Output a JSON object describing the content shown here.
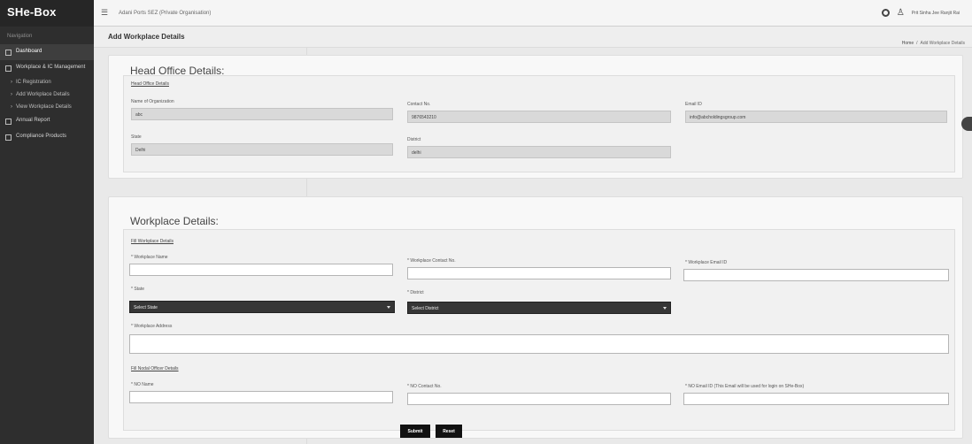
{
  "brand": "SHe-Box",
  "sidebar": {
    "heading": "Navigation",
    "items": [
      {
        "label": "Dashboard",
        "active": true
      },
      {
        "label": "Workplace & IC Management",
        "active": false
      },
      {
        "label": "IC Registration",
        "sub": true
      },
      {
        "label": "Add Workplace Details",
        "sub": true
      },
      {
        "label": "View Workplace Details",
        "sub": true
      },
      {
        "label": "Annual Report",
        "active": false
      },
      {
        "label": "Compliance Products",
        "active": false
      }
    ]
  },
  "topbar": {
    "org_name": "Adani Ports SEZ (Private Organisation)",
    "user_name": "Prit Sinha Jee Ranjit Rai"
  },
  "titlebar": {
    "title": "Add Workplace Details",
    "breadcrumb_home": "Home",
    "breadcrumb_sep": "/",
    "breadcrumb_current": "Add Workplace Details"
  },
  "head_office": {
    "card_title": "Head Office Details:",
    "section_link": "Head Office Details",
    "org_label": "Name of Organization",
    "org_value": "abc",
    "contact_label": "Contact No.",
    "contact_value": "9876543210",
    "email_label": "Email ID",
    "email_value": "info@abcholdingsgroup.com",
    "state_label": "State",
    "state_value": "Delhi",
    "district_label": "District",
    "district_value": "delhi"
  },
  "workplace": {
    "card_title": "Workplace Details:",
    "section_link": "Fill Workplace Details",
    "name_label": "* Workplace Name",
    "contact_label": "* Workplace Contact No.",
    "email_label": "* Workplace Email ID",
    "state_label": "* State",
    "state_select": "Select State",
    "district_label": "* District",
    "district_select": "Select District",
    "address_label": "* Workplace Address",
    "nodal_link": "Fill Nodal Officer Details",
    "no_name_label": "* NO Name",
    "no_contact_label": "* NO Contact No.",
    "no_email_label": "* NO Email ID (This Email will be used for login on SHe-Box)"
  },
  "buttons": {
    "submit": "Submit",
    "reset": "Reset"
  }
}
